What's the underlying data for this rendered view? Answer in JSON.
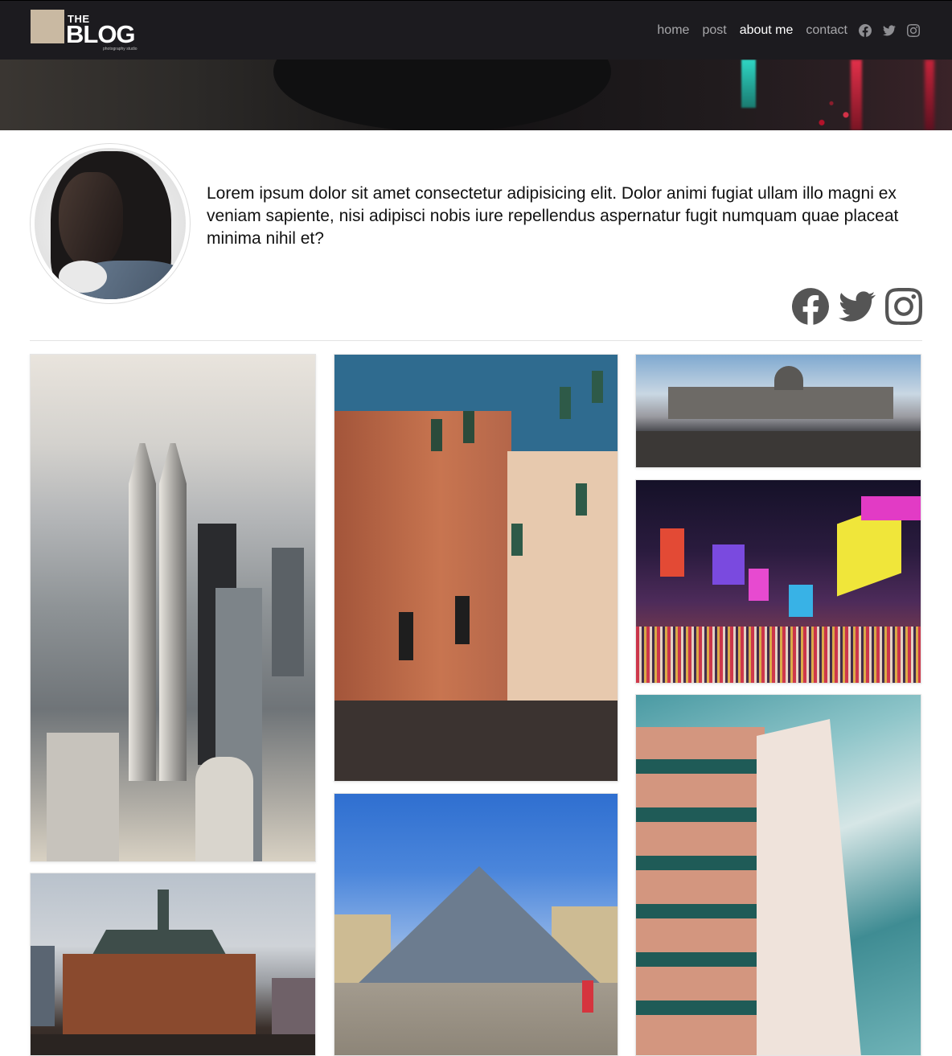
{
  "nav": {
    "logo_the": "THE",
    "logo_blog": "BLOG",
    "logo_sub": "photography studio",
    "links": [
      {
        "label": "home",
        "active": false
      },
      {
        "label": "post",
        "active": false
      },
      {
        "label": "about me",
        "active": true
      },
      {
        "label": "contact",
        "active": false
      }
    ],
    "icons": [
      "facebook-icon",
      "twitter-icon",
      "instagram-icon"
    ]
  },
  "profile": {
    "bio": "Lorem ipsum dolor sit amet consectetur adipisicing elit. Dolor animi fugiat ullam illo magni ex veniam sapiente, nisi adipisci nobis iure repellendus aspernatur fugit numquam quae placeat minima nihil et?",
    "social_icons": [
      "facebook-icon",
      "twitter-icon",
      "instagram-icon"
    ]
  },
  "gallery": {
    "photos": [
      {
        "subject": "city skyline with twin towers in fog"
      },
      {
        "subject": "venetian buildings by a canal"
      },
      {
        "subject": "panoramic plaza with domed building"
      },
      {
        "subject": "times square at night"
      },
      {
        "subject": "modern building against cloudy sky"
      },
      {
        "subject": "historic railroad terminal on waterfront"
      },
      {
        "subject": "glass pyramid at the louvre"
      }
    ]
  },
  "colors": {
    "navbar_bg": "#1c1b1f",
    "nav_link": "#a8a8ab",
    "nav_link_active": "#ffffff",
    "logo_accent": "#c9b9a2",
    "social_icon": "#555555"
  }
}
